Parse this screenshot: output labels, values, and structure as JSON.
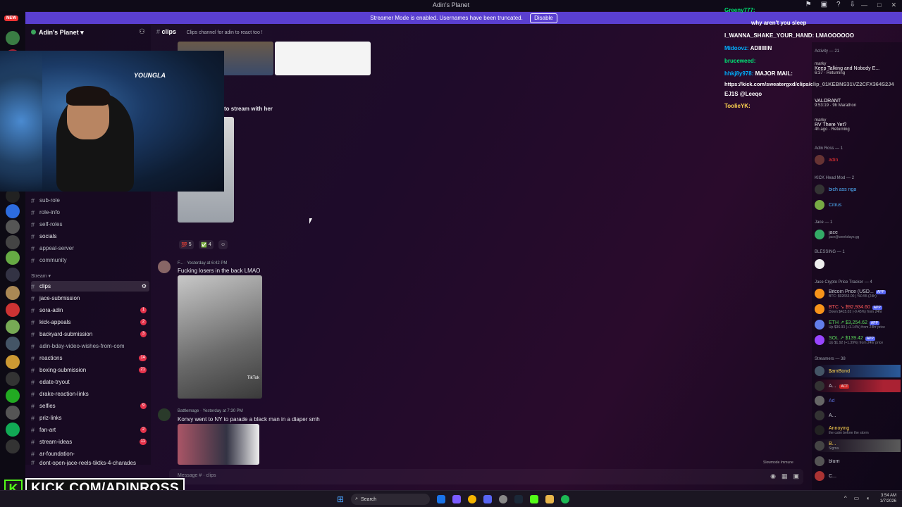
{
  "window": {
    "title": "Adin's Planet",
    "controls": [
      "—",
      "□",
      "✕"
    ]
  },
  "banner": {
    "text": "Streamer Mode is enabled. Usernames have been truncated.",
    "disable_label": "Disable"
  },
  "server": {
    "name": "Adin's Planet",
    "new_label": "NEW"
  },
  "channel_header": {
    "name": "clips",
    "topic": "Clips channel for adin to react too !"
  },
  "channels": [
    {
      "name": "sub-role",
      "badge": ""
    },
    {
      "name": "role-info",
      "badge": ""
    },
    {
      "name": "self-roles",
      "badge": ""
    },
    {
      "name": "socials",
      "badge": ""
    },
    {
      "name": "appeal-server",
      "badge": ""
    },
    {
      "name": "community",
      "badge": ""
    }
  ],
  "stream_category": "Stream",
  "stream_channels": [
    {
      "name": "clips",
      "badge": ""
    },
    {
      "name": "jace-submission",
      "badge": ""
    },
    {
      "name": "sora-adin",
      "badge": "1"
    },
    {
      "name": "kick-appeals",
      "badge": "2"
    },
    {
      "name": "backyard-submission",
      "badge": "3"
    },
    {
      "name": "adin-bday-video-wishes-from-com",
      "badge": ""
    },
    {
      "name": "reactions",
      "badge": "14"
    },
    {
      "name": "boxing-submission",
      "badge": "21"
    },
    {
      "name": "edate-tryout",
      "badge": ""
    },
    {
      "name": "drake-reaction-links",
      "badge": ""
    },
    {
      "name": "selfies",
      "badge": "9"
    },
    {
      "name": "priz-links",
      "badge": ""
    },
    {
      "name": "fan-art",
      "badge": "2"
    },
    {
      "name": "stream-ideas",
      "badge": "11"
    },
    {
      "name": "ar-foundation-",
      "badge": ""
    },
    {
      "name": "dont-open-jace-reels-tiktks-4-charades",
      "badge": ""
    }
  ],
  "messages": {
    "partial_text": "to stream with her",
    "reactions": [
      {
        "emoji": "💯",
        "count": "5"
      },
      {
        "emoji": "✅",
        "count": "4"
      }
    ],
    "msg1": {
      "author": "F...",
      "time": "Yesterday at 6:42 PM",
      "text": "Fucking losers in the back LMAO",
      "tiktok": "TikTok"
    },
    "msg2": {
      "author": "Battlemage",
      "time": "Yesterday at 7:30 PM",
      "text": "Konvy went to NY to parade a black man in a diaper smh"
    }
  },
  "composer": {
    "placeholder": "Message # · clips",
    "slowmode": "Slowmode Immune"
  },
  "chat_overlay": [
    {
      "user": "Greeny777:",
      "text": "",
      "color": "u"
    },
    {
      "user": "",
      "text": "why aren't you sleep",
      "color": "u"
    },
    {
      "user": "",
      "text": "I_WANNA_SHAKE_YOUR_HAND: LMAOOOOOO",
      "color": "m"
    },
    {
      "user": "Midoovz:",
      "text": "ADIIIIIIN",
      "color": "ub"
    },
    {
      "user": "bruceweed:",
      "text": "",
      "color": "u"
    },
    {
      "user": "hhkj8y978:",
      "text": "MAJOR MAIL:",
      "color": "ub"
    },
    {
      "user": "",
      "text": "https://kick.com/sweatergxd/clips/clip_01KEBNS31VZ2CFX364S2J4",
      "color": "m"
    },
    {
      "user": "",
      "text": "EJ1S @Leeqo",
      "color": "m"
    },
    {
      "user": "ToolieYK:",
      "text": "",
      "color": "uy"
    }
  ],
  "members": {
    "activity_header": "Activity — 21",
    "activity": [
      {
        "name": "marky",
        "title": "Keep Talking and Nobody E...",
        "sub": "6:37 · Returning"
      },
      {
        "name": "",
        "title": "VALORANT",
        "sub": "9:53:19 · 9h Marathon"
      },
      {
        "name": "marky",
        "title": "RV There Yet?",
        "sub": "4h ago · Returning"
      }
    ],
    "groups": [
      {
        "header": "Adin Ross — 1",
        "rows": [
          {
            "name": "adin",
            "sub": ""
          }
        ]
      },
      {
        "header": "KICK Head Mod — 2",
        "rows": [
          {
            "name": "bich ass nga",
            "sub": ""
          },
          {
            "name": "Citrus",
            "sub": ""
          }
        ]
      },
      {
        "header": "Jace — 1",
        "rows": [
          {
            "name": "jace",
            "sub": "jace@weekdays.gg"
          }
        ]
      },
      {
        "header": "BLESSING — 1",
        "rows": [
          {
            "name": "",
            "sub": ""
          }
        ]
      },
      {
        "header": "Jace Crypto Price Tracker — 4",
        "rows": [
          {
            "name": "Bitcoin Price (USD...",
            "sub": "BTC: $92653.00 | %0.55 (24h)",
            "app": "APP"
          },
          {
            "name": "BTC ↘ $92,934.60",
            "sub": "Down $415.02 (-0.45%) from 24hr",
            "app": "APP"
          },
          {
            "name": "ETH ↗ $3,254.62",
            "sub": "Up $36.93 (+1.14%) from 24hr price",
            "app": "APP"
          },
          {
            "name": "SOL ↗ $139.42",
            "sub": "Up $1.92 (+1.39%) from 24hr price",
            "app": "APP"
          }
        ]
      },
      {
        "header": "Streamers — 38",
        "rows": [
          {
            "name": "$amBond",
            "sub": ""
          },
          {
            "name": "A...",
            "sub": "ACT"
          },
          {
            "name": "Ad",
            "sub": ""
          },
          {
            "name": "A...",
            "sub": ""
          },
          {
            "name": "Annoying",
            "sub": "the calm before the storm"
          },
          {
            "name": "B...",
            "sub": "Sigma"
          },
          {
            "name": "blurri",
            "sub": ""
          },
          {
            "name": "C...",
            "sub": ""
          }
        ]
      }
    ]
  },
  "taskbar": {
    "search_label": "Search",
    "time": "3:54 AM",
    "date": "1/7/2026"
  },
  "kick_banner": {
    "logo": "K",
    "text": "KICK.COM/ADINROSS"
  },
  "webcam": {
    "brand_text": "YOUNGLA"
  }
}
